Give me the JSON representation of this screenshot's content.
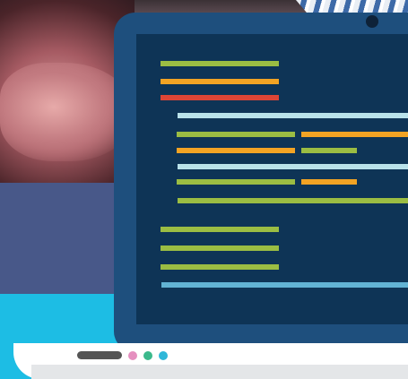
{
  "colors": {
    "lid": "#1e4f7d",
    "screen": "#0e3456",
    "code_green": "#9bbd43",
    "code_orange": "#f2a324",
    "code_red": "#dd4536",
    "code_pale_blue": "#b9e2ea",
    "code_blue": "#62b3d4",
    "background_navy": "#485889",
    "background_cyan": "#1dbde4"
  },
  "illustration": {
    "subject": "laptop-with-code-editor",
    "base_dots": [
      "#e58fbf",
      "#3bb98c",
      "#2fb7d8"
    ]
  }
}
